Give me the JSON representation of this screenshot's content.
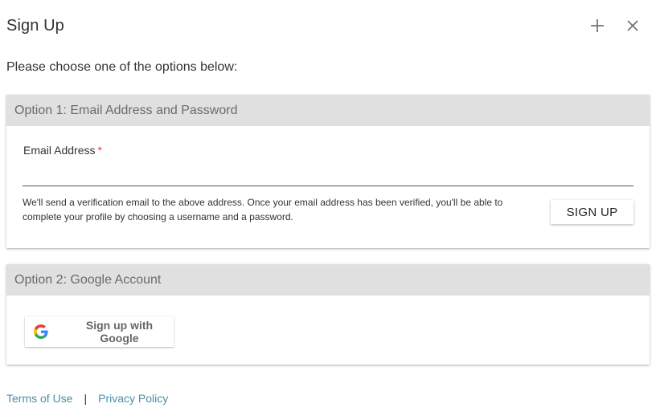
{
  "dialog": {
    "title": "Sign Up",
    "intro": "Please choose one of the options below:"
  },
  "option1": {
    "header": "Option 1: Email Address and Password",
    "email_label": "Email Address",
    "required_mark": "*",
    "email_value": "",
    "help_text": "We'll send a verification email to the above address. Once your email address has been verified, you'll be able to complete your profile by choosing a username and a password.",
    "signup_label": "SIGN UP"
  },
  "option2": {
    "header": "Option 2: Google Account",
    "google_label": "Sign up with Google",
    "google_icon": "google-g-icon"
  },
  "footer": {
    "terms": "Terms of Use",
    "separator": "|",
    "privacy": "Privacy Policy"
  },
  "colors": {
    "link": "#4a8fa3",
    "required": "#e53935",
    "card_header_bg": "#e0e0e0"
  },
  "icons": {
    "add": "plus-icon",
    "close": "close-icon"
  }
}
